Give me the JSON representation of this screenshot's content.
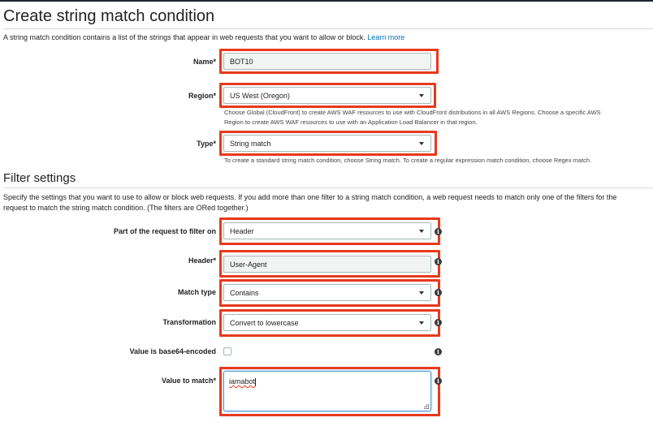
{
  "page": {
    "title": "Create string match condition",
    "description": "A string match condition contains a list of the strings that appear in web requests that you want to allow or block.",
    "learn_more": "Learn more"
  },
  "name_field": {
    "label": "Name*",
    "value": "BOT10"
  },
  "region_field": {
    "label": "Region*",
    "value": "US West (Oregon)",
    "help_line1": "Choose Global (CloudFront) to create AWS WAF resources to use with CloudFront distributions in all AWS Regions. Choose a specific AWS",
    "help_line2": "Region to create AWS WAF resources to use with an Application Load Balancer in that region."
  },
  "type_field": {
    "label": "Type*",
    "value": "String match",
    "help": "To create a standard string match condition, choose String match. To create a regular expression match condition, choose Regex match."
  },
  "filter": {
    "heading": "Filter settings",
    "description_line1": "Specify the settings that you want to use to allow or block web requests. If you add more than one filter to a string match condition, a web request needs to match only one of the filters for the",
    "description_line2": "request to match the string match condition. (The filters are ORed together.)",
    "part": {
      "label": "Part of the request to filter on",
      "value": "Header"
    },
    "header": {
      "label": "Header*",
      "value": "User-Agent"
    },
    "match_type": {
      "label": "Match type",
      "value": "Contains"
    },
    "transformation": {
      "label": "Transformation",
      "value": "Convert to lowercase"
    },
    "base64": {
      "label": "Value is base64-encoded",
      "checked": false
    },
    "value_to_match": {
      "label": "Value to match*",
      "value": "iamabot"
    }
  },
  "info_icon_glyph": "i",
  "colors": {
    "highlight": "#e8391c",
    "link": "#0073bb",
    "border": "#aab7b8"
  }
}
